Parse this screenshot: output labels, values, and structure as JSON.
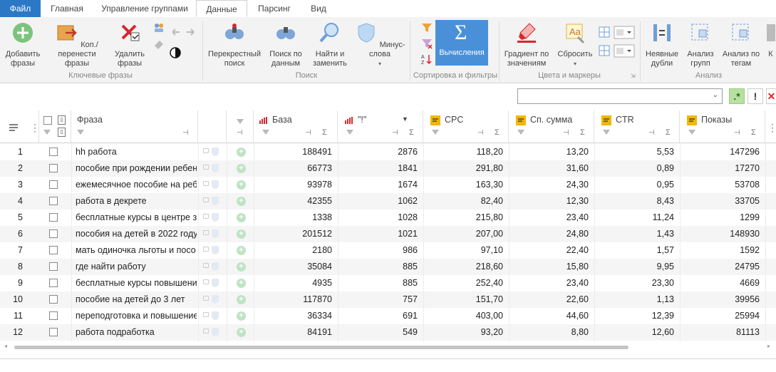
{
  "tabs": [
    "Файл",
    "Главная",
    "Управление группами",
    "Данные",
    "Парсинг",
    "Вид"
  ],
  "ribbon": {
    "groups": [
      "Ключевые фразы",
      "Поиск",
      "Сортировка и фильтры",
      "Цвета и маркеры",
      "Анализ"
    ],
    "buttons": {
      "add": "Добавить фразы",
      "copy_move": "Коп./перенести фразы",
      "delete": "Удалить фразы",
      "cross": "Перекрестный поиск",
      "search_data": "Поиск по данным",
      "find_replace": "Найти и заменить",
      "minus": "Минус-слова",
      "calc": "Вычисления",
      "gradient": "Градиент по значениям",
      "reset": "Сбросить",
      "implicit": "Неявные дубли",
      "analysis_groups": "Анализ групп",
      "analysis_tags": "Анализ по тегам",
      "cut": "К"
    }
  },
  "columns": {
    "phrase": "Фраза",
    "base": "База",
    "excl": "\"!\"",
    "cpc": "CPC",
    "sum": "Сп. сумма",
    "ctr": "CTR",
    "shows": "Показы"
  },
  "rows": [
    {
      "n": "1",
      "phrase": "hh работа",
      "base": "188491",
      "excl": "2876",
      "cpc": "118,20",
      "sum": "13,20",
      "ctr": "5,53",
      "shows": "147296"
    },
    {
      "n": "2",
      "phrase": "пособие при рождении ребен",
      "base": "66773",
      "excl": "1841",
      "cpc": "291,80",
      "sum": "31,60",
      "ctr": "0,89",
      "shows": "17270"
    },
    {
      "n": "3",
      "phrase": "ежемесячное пособие на реб",
      "base": "93978",
      "excl": "1674",
      "cpc": "163,30",
      "sum": "24,30",
      "ctr": "0,95",
      "shows": "53708"
    },
    {
      "n": "4",
      "phrase": "работа в декрете",
      "base": "42355",
      "excl": "1062",
      "cpc": "82,40",
      "sum": "12,30",
      "ctr": "8,43",
      "shows": "33705"
    },
    {
      "n": "5",
      "phrase": "бесплатные курсы в центре за",
      "base": "1338",
      "excl": "1028",
      "cpc": "215,80",
      "sum": "23,40",
      "ctr": "11,24",
      "shows": "1299"
    },
    {
      "n": "6",
      "phrase": "пособия на детей в 2022 году",
      "base": "201512",
      "excl": "1021",
      "cpc": "207,00",
      "sum": "24,80",
      "ctr": "1,43",
      "shows": "148930"
    },
    {
      "n": "7",
      "phrase": "мать одиночка льготы и посо",
      "base": "2180",
      "excl": "986",
      "cpc": "97,10",
      "sum": "22,40",
      "ctr": "1,57",
      "shows": "1592"
    },
    {
      "n": "8",
      "phrase": "где найти работу",
      "base": "35084",
      "excl": "885",
      "cpc": "218,60",
      "sum": "15,80",
      "ctr": "9,95",
      "shows": "24795"
    },
    {
      "n": "9",
      "phrase": "бесплатные курсы повышени",
      "base": "4935",
      "excl": "885",
      "cpc": "252,40",
      "sum": "23,40",
      "ctr": "23,30",
      "shows": "4669"
    },
    {
      "n": "10",
      "phrase": "пособие на детей до 3 лет",
      "base": "117870",
      "excl": "757",
      "cpc": "151,70",
      "sum": "22,60",
      "ctr": "1,13",
      "shows": "39956"
    },
    {
      "n": "11",
      "phrase": "переподготовка и повышение",
      "base": "36334",
      "excl": "691",
      "cpc": "403,00",
      "sum": "44,60",
      "ctr": "12,39",
      "shows": "25994"
    },
    {
      "n": "12",
      "phrase": "работа подработка",
      "base": "84191",
      "excl": "549",
      "cpc": "93,20",
      "sum": "8,80",
      "ctr": "12,60",
      "shows": "81113"
    }
  ],
  "colors": {
    "accent": "#2b78c5",
    "calc": "#4a90d9",
    "chart_red": "#d9262f",
    "gold": "#f2b705"
  }
}
